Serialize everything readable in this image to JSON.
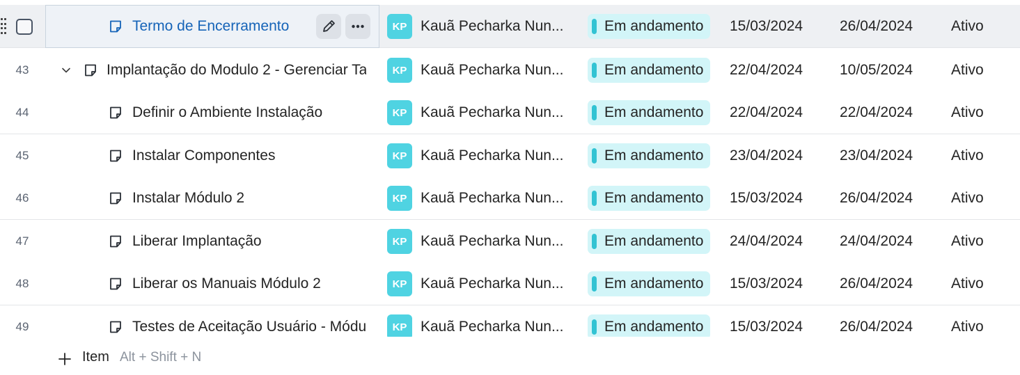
{
  "rows": [
    {
      "num": "",
      "title": "Termo de Encerramento",
      "person": "Kauã Pecharka Nun...",
      "initials": "KP",
      "status": "Em andamento",
      "start": "15/03/2024",
      "end": "26/04/2024",
      "state": "Ativo"
    },
    {
      "num": "43",
      "title": "Implantação do Modulo 2 - Gerenciar Ta",
      "person": "Kauã Pecharka Nun...",
      "initials": "KP",
      "status": "Em andamento",
      "start": "22/04/2024",
      "end": "10/05/2024",
      "state": "Ativo"
    },
    {
      "num": "44",
      "title": "Definir o Ambiente Instalação",
      "person": "Kauã Pecharka Nun...",
      "initials": "KP",
      "status": "Em andamento",
      "start": "22/04/2024",
      "end": "22/04/2024",
      "state": "Ativo"
    },
    {
      "num": "45",
      "title": "Instalar Componentes",
      "person": "Kauã Pecharka Nun...",
      "initials": "KP",
      "status": "Em andamento",
      "start": "23/04/2024",
      "end": "23/04/2024",
      "state": "Ativo"
    },
    {
      "num": "46",
      "title": "Instalar Módulo 2",
      "person": "Kauã Pecharka Nun...",
      "initials": "KP",
      "status": "Em andamento",
      "start": "15/03/2024",
      "end": "26/04/2024",
      "state": "Ativo"
    },
    {
      "num": "47",
      "title": "Liberar Implantação",
      "person": "Kauã Pecharka Nun...",
      "initials": "KP",
      "status": "Em andamento",
      "start": "24/04/2024",
      "end": "24/04/2024",
      "state": "Ativo"
    },
    {
      "num": "48",
      "title": "Liberar os Manuais Módulo 2",
      "person": "Kauã Pecharka Nun...",
      "initials": "KP",
      "status": "Em andamento",
      "start": "15/03/2024",
      "end": "26/04/2024",
      "state": "Ativo"
    },
    {
      "num": "49",
      "title": "Testes de Aceitação Usuário - Módul",
      "person": "Kauã Pecharka Nun...",
      "initials": "KP",
      "status": "Em andamento",
      "start": "15/03/2024",
      "end": "26/04/2024",
      "state": "Ativo"
    }
  ],
  "footer": {
    "add_label": "Item",
    "shortcut": "Alt + Shift + N"
  },
  "colors": {
    "avatar": "#4fd3e2",
    "status_bg": "#d2f5f8",
    "status_bar": "#32c3d3",
    "link": "#1664b8"
  },
  "icons": {
    "drag": "drag-handle-icon",
    "task": "task-note-icon",
    "edit": "pencil-icon",
    "more": "more-horizontal-icon",
    "expand": "chevron-down-icon",
    "add": "plus-icon"
  }
}
